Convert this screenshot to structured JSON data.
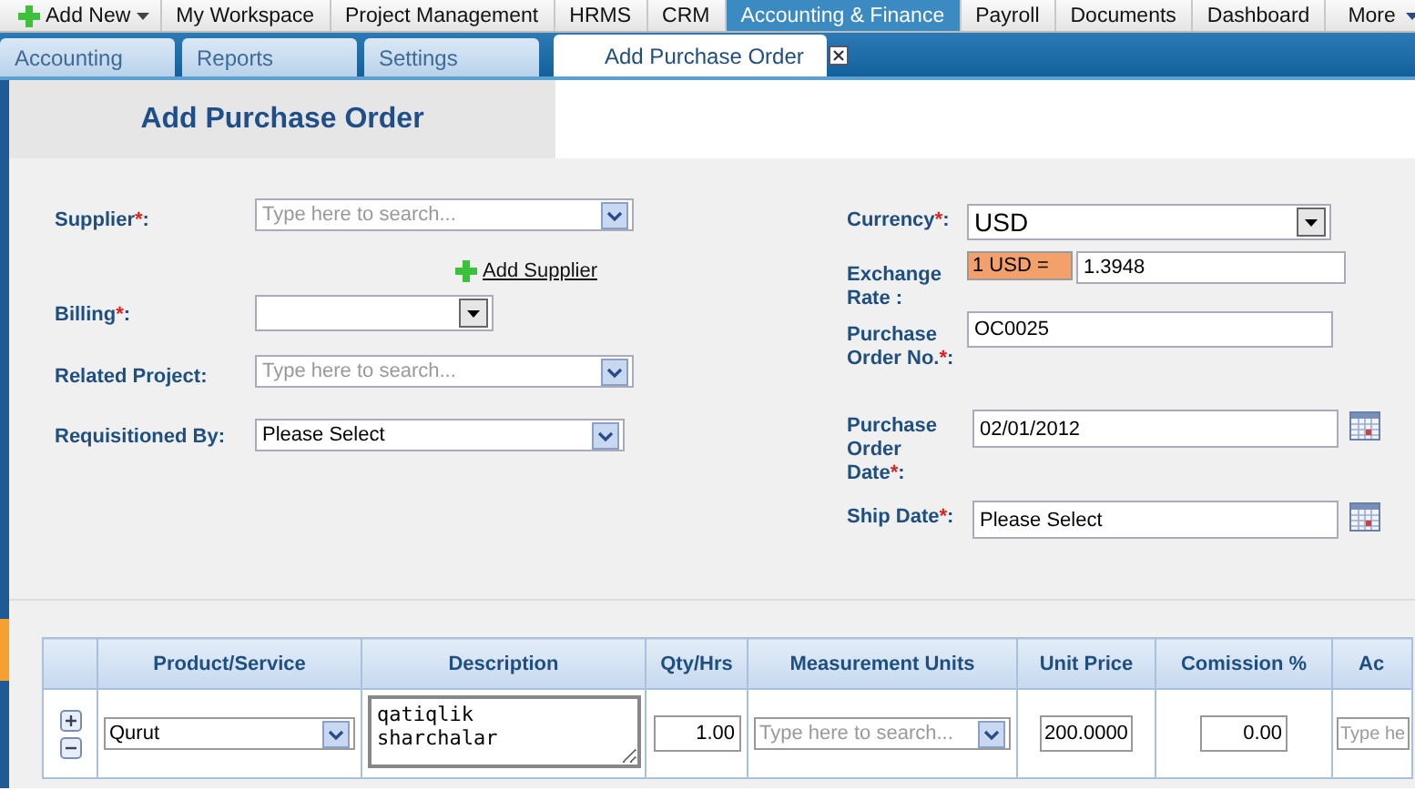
{
  "top_nav": {
    "add_new": "Add New",
    "items": [
      {
        "label": "My Workspace",
        "selected": false
      },
      {
        "label": "Project Management",
        "selected": false
      },
      {
        "label": "HRMS",
        "selected": false
      },
      {
        "label": "CRM",
        "selected": false
      },
      {
        "label": "Accounting & Finance",
        "selected": true
      },
      {
        "label": "Payroll",
        "selected": false
      },
      {
        "label": "Documents",
        "selected": false
      },
      {
        "label": "Dashboard",
        "selected": false
      }
    ],
    "more": "More"
  },
  "tabs": [
    {
      "label": "Accounting",
      "selected": false,
      "closable": false
    },
    {
      "label": "Reports",
      "selected": false,
      "closable": false
    },
    {
      "label": "Settings",
      "selected": false,
      "closable": false
    },
    {
      "label": "Add Purchase Order",
      "selected": true,
      "closable": true
    }
  ],
  "page_title": "Add Purchase Order",
  "form": {
    "left": [
      {
        "kind": "search",
        "label": "Supplier",
        "required_mark": "*",
        "label_end": ":",
        "placeholder": "Type here to search..."
      },
      {
        "kind": "link",
        "label": "Add Supplier"
      },
      {
        "kind": "select",
        "label": "Billing",
        "required_mark": "*",
        "label_end": ":"
      },
      {
        "kind": "search",
        "label": "Related Project:",
        "placeholder": "Type here to search..."
      },
      {
        "kind": "combo",
        "label": "Requisitioned By:",
        "value": "Please Select"
      }
    ],
    "right": [
      {
        "kind": "select",
        "label": "Currency",
        "required_mark": "*",
        "label_end": ":",
        "value": "USD"
      },
      {
        "kind": "rate",
        "label": "Exchange Rate :",
        "prefix": "1 USD =",
        "value": "1.3948"
      },
      {
        "kind": "text",
        "label": "Purchase Order No.",
        "required_mark": "*",
        "label_end": ":",
        "value": "OC0025"
      },
      {
        "kind": "date",
        "label": "Purchase Order Date",
        "required_mark": "*",
        "label_end": ":",
        "value": "02/01/2012"
      },
      {
        "kind": "date",
        "label": "Ship Date",
        "required_mark": "*",
        "label_end": ":",
        "value": "Please Select"
      }
    ]
  },
  "table": {
    "columns": [
      "Product/Service",
      "Description",
      "Qty/Hrs",
      "Measurement Units",
      "Unit Price",
      "Comission %",
      "Ac"
    ],
    "rows": [
      {
        "cells": [
          {
            "kind": "combo",
            "value": "Qurut"
          },
          {
            "kind": "textarea",
            "value": "qatiqlik\nsharchalar"
          },
          {
            "kind": "number",
            "value": "1.00"
          },
          {
            "kind": "search",
            "placeholder": "Type here to search..."
          },
          {
            "kind": "number",
            "value": "200.0000"
          },
          {
            "kind": "number",
            "value": "0.00"
          },
          {
            "kind": "text",
            "placeholder": "Type he"
          }
        ]
      }
    ]
  }
}
